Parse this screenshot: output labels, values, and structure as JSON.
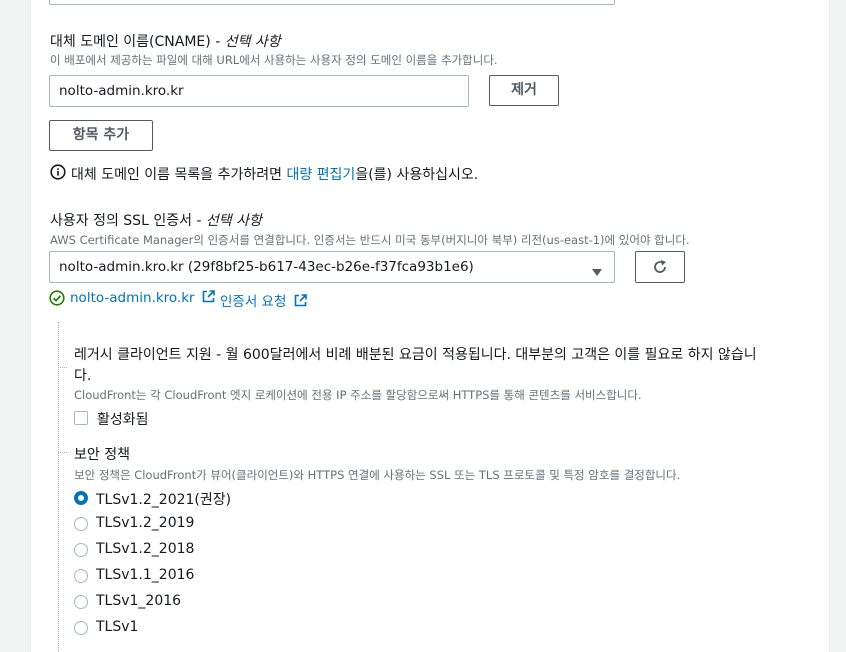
{
  "cname": {
    "label": "대체 도메인 이름(CNAME)",
    "optional": "- 선택 사항",
    "description": "이 배포에서 제공하는 파일에 대해 URL에서 사용하는 사용자 정의 도메인 이름을 추가합니다.",
    "value": "nolto-admin.kro.kr",
    "remove_button": "제거",
    "add_button": "항목 추가",
    "info_prefix": "대체 도메인 이름 목록을 추가하려면",
    "info_link": "대량 편집기",
    "info_suffix": "을(를) 사용하십시오."
  },
  "ssl": {
    "label": "사용자 정의 SSL 인증서",
    "optional": "- 선택 사항",
    "description": "AWS Certificate Manager의 인증서를 연결합니다. 인증서는 반드시 미국 동부(버지니아 북부) 리전(us-east-1)에 있어야 합니다.",
    "selected": "nolto-admin.kro.kr (29f8bf25-b617-43ec-b26e-f37fca93b1e6)",
    "status_link": "nolto-admin.kro.kr",
    "request_link": "인증서 요청"
  },
  "legacy": {
    "title_line1": "레거시 클라이언트 지원 - 월 600달러에서 비례 배분된 요금이 적용됩니다. 대부분의 고객은 이를 필요로 하지 않습니",
    "title_line2": "다.",
    "description": "CloudFront는 각 CloudFront 엣지 로케이션에 전용 IP 주소를 할당함으로써 HTTPS를 통해 콘텐츠를 서비스합니다.",
    "checkbox_label": "활성화됨"
  },
  "security_policy": {
    "title": "보안 정책",
    "description": "보안 정책은 CloudFront가 뷰어(클라이언트)와 HTTPS 연결에 사용하는 SSL 또는 TLS 프로토콜 및 특정 암호를 결정합니다.",
    "options": [
      "TLSv1.2_2021(권장)",
      "TLSv1.2_2019",
      "TLSv1.2_2018",
      "TLSv1.1_2016",
      "TLSv1_2016",
      "TLSv1"
    ],
    "selected": "TLSv1.2_2021(권장)"
  },
  "colors": {
    "link": "#0073bb",
    "success": "#1d8102",
    "border": "#aab7b8"
  }
}
